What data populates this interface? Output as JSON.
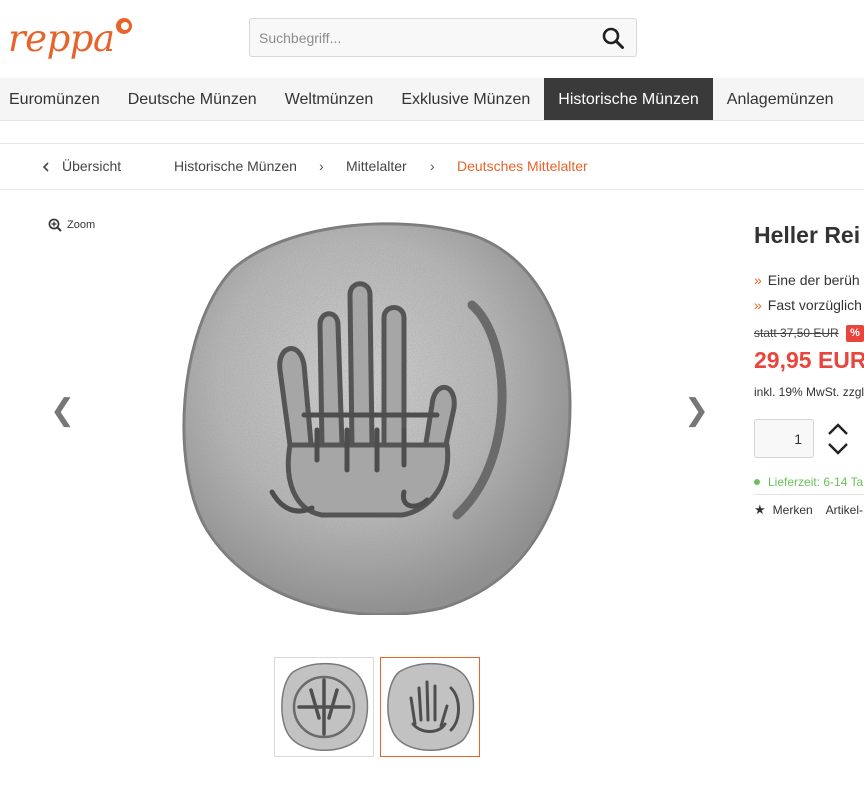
{
  "header": {
    "logo_text": "reppa",
    "search": {
      "placeholder": "Suchbegriff..."
    },
    "icons": {
      "search": "magnifier-icon",
      "logo_mark": "dot-mark-icon"
    },
    "brand_color": "#e8632a"
  },
  "nav": {
    "items": [
      {
        "label": "Euromünzen",
        "active": false
      },
      {
        "label": "Deutsche Münzen",
        "active": false
      },
      {
        "label": "Weltmünzen",
        "active": false
      },
      {
        "label": "Exklusive Münzen",
        "active": false
      },
      {
        "label": "Historische Münzen",
        "active": true
      },
      {
        "label": "Anlagemünzen",
        "active": false
      }
    ],
    "active_color": "#3a3a3a"
  },
  "breadcrumb": {
    "back_label": "Übersicht",
    "items": [
      "Historische Münzen",
      "Mittelalter",
      "Deutsches Mittelalter"
    ],
    "separator": "›",
    "back_icon": "chevron-left-icon"
  },
  "gallery": {
    "zoom_label": "Zoom",
    "prev_arrow": "❮",
    "next_arrow": "❯",
    "thumbnail_count": 2,
    "active_thumbnail": 2,
    "icons": {
      "zoom": "zoom-in-icon",
      "prev": "chevron-left-icon",
      "next": "chevron-right-icon"
    }
  },
  "product": {
    "title": "Heller Rei",
    "bullets": [
      {
        "mark": "»",
        "text": "Eine der berüh"
      },
      {
        "mark": "»",
        "text": "Fast vorzüglich"
      }
    ],
    "old_price": "statt 37,50 EUR",
    "discount_badge": "%",
    "price": "29,95 EUR",
    "tax_note": "inkl. 19% MwSt. zzgl",
    "quantity": "1",
    "delivery": "Lieferzeit: 6-14 Ta",
    "merken_label": "Merken",
    "artikel_label": "Artikel-",
    "price_color": "#e8453c",
    "delivery_color": "#6cc05a",
    "icons": {
      "star": "star-icon",
      "qty_up": "chevron-up-icon",
      "qty_down": "chevron-down-icon"
    }
  }
}
